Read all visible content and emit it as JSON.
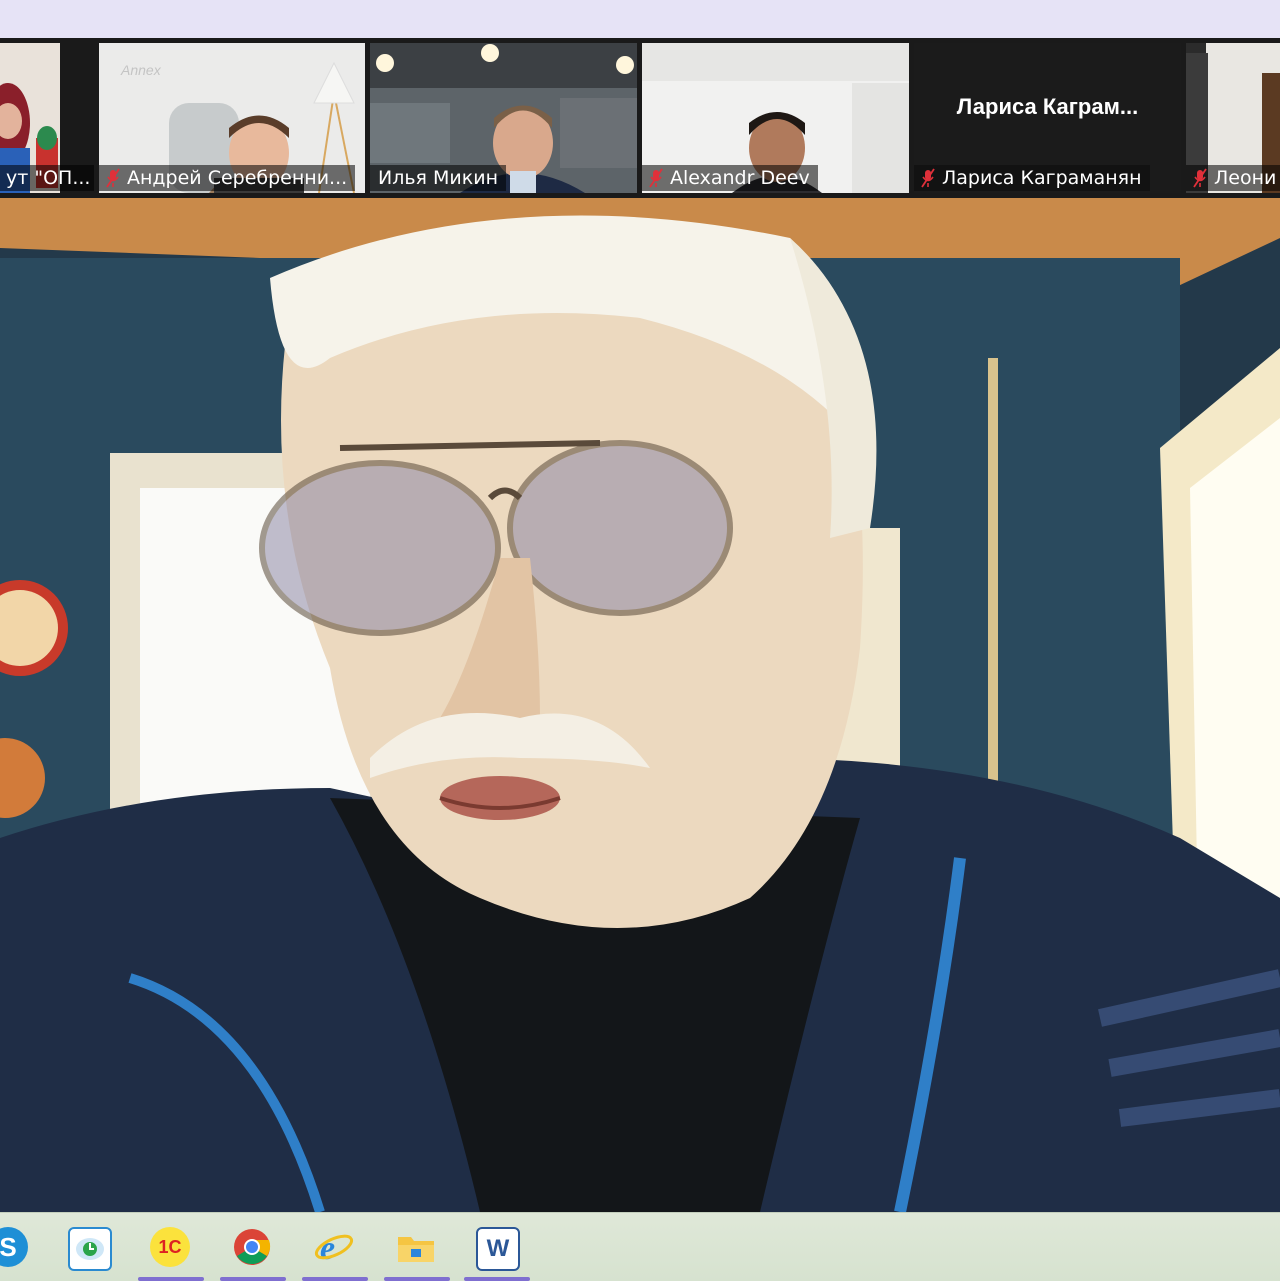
{
  "participants": [
    {
      "name": "ут \"ОП...",
      "muted": false
    },
    {
      "name": "Андрей Серебренни...",
      "muted": true
    },
    {
      "name": "Илья Микин",
      "muted": false
    },
    {
      "name": "Alexandr Deev",
      "muted": true
    },
    {
      "name": "Лариса Каграманян",
      "display_name": "Лариса  Каграм...",
      "muted": true
    },
    {
      "name": "Леони",
      "muted": true
    }
  ],
  "taskbar": {
    "apps": [
      "skype-icon",
      "clock-app-icon",
      "1c-icon",
      "chrome-icon",
      "internet-explorer-icon",
      "file-explorer-icon",
      "word-icon"
    ],
    "onec_label": "1С",
    "word_label": "W"
  },
  "colors": {
    "top_band": "#e6e3f6",
    "strip_bg": "#1a1a1a",
    "mute_red": "#e0303a",
    "taskbar_bg": "#dfe8d8",
    "active_underline": "#7f6fd0"
  }
}
